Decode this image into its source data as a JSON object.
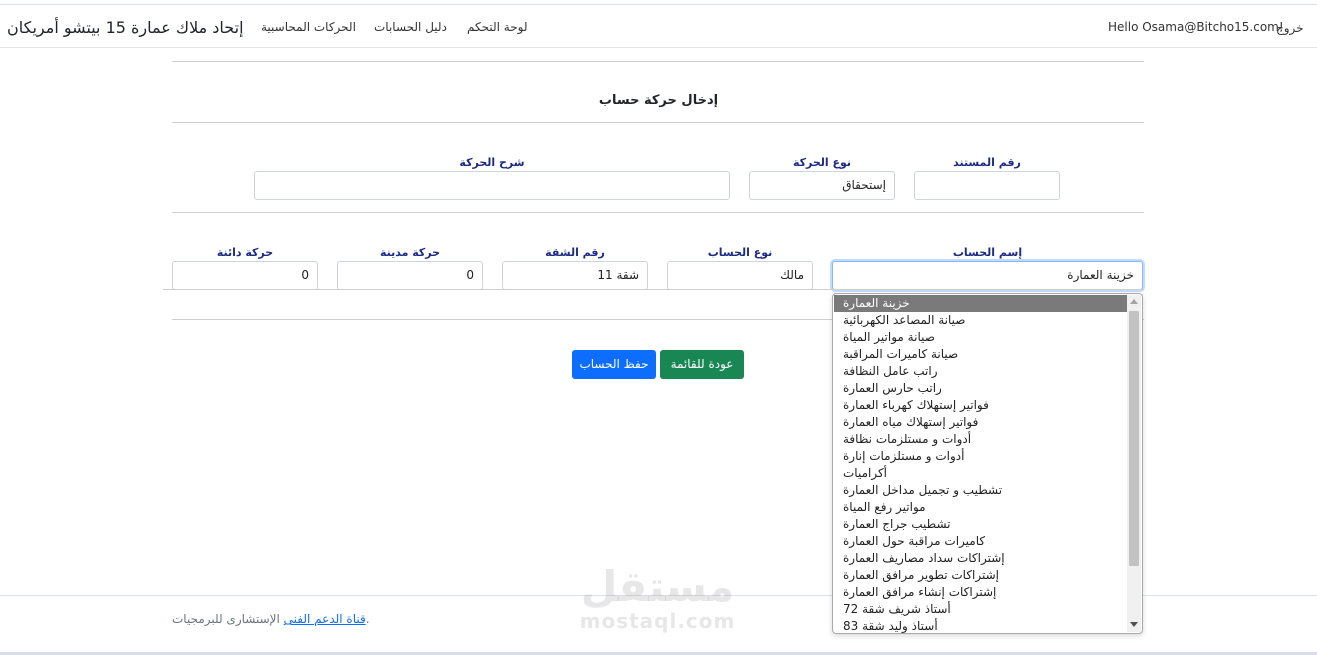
{
  "navbar": {
    "brand": "إتحاد ملاك عمارة 15 بيتشو أمريكان",
    "links": [
      "الحركات المحاسبية",
      "دليل الحسابات",
      "لوحة التحكم"
    ],
    "hello": "Hello Osama@Bitcho15.com!",
    "logout": "خروج"
  },
  "form": {
    "title": "إدخال حركة حساب",
    "doc_number_label": "رقم المستند",
    "doc_number_value": "",
    "type_label": "نوع الحركة",
    "type_value": "إستحقاق",
    "description_label": "شرح الحركة",
    "description_value": "",
    "account_name_label": "إسم الحساب",
    "account_name_value": "خزينة العمارة",
    "account_type_label": "نوع الحساب",
    "account_type_value": "مالك",
    "apartment_label": "رقم الشقة",
    "apartment_value": "شقة 11",
    "debit_label": "حركة مدينة",
    "debit_value": "0",
    "credit_label": "حركة دائنة",
    "credit_value": "0"
  },
  "buttons": {
    "save": "حفظ الحساب",
    "back": "عودة للقائمة"
  },
  "dropdown": {
    "selected_index": 0,
    "options": [
      "خزينة العمارة",
      "صيانة المصاعد الكهربائية",
      "صيانة مواتير المياة",
      "صيانة كاميرات المراقبة",
      "راتب عامل النظافة",
      "راتب حارس العمارة",
      "فواتير إستهلاك كهرباء العمارة",
      "فواتير إستهلاك مياه العمارة",
      "أدوات و مستلزمات نظافة",
      "أدوات و مستلزمات إنارة",
      "أكراميات",
      "تشطيب و تجميل مداخل العمارة",
      "مواتير رفع المياة",
      "تشطيب جراج العمارة",
      "كاميرات مراقبة حول العمارة",
      "إشتراكات سداد مصاريف العمارة",
      "إشتراكات تطوير مرافق العمارة",
      "إشتراكات إنشاء مرافق العمارة",
      "أستاذ شريف شقة 72",
      "أستاذ وليد شقة 83"
    ]
  },
  "footer": {
    "text": "الإستشارى للبرمجيات",
    "link": "قناة الدعم الفنى",
    "suffix": "."
  },
  "watermark": {
    "arabic": "مستقل",
    "latin": "mostaql.com"
  }
}
